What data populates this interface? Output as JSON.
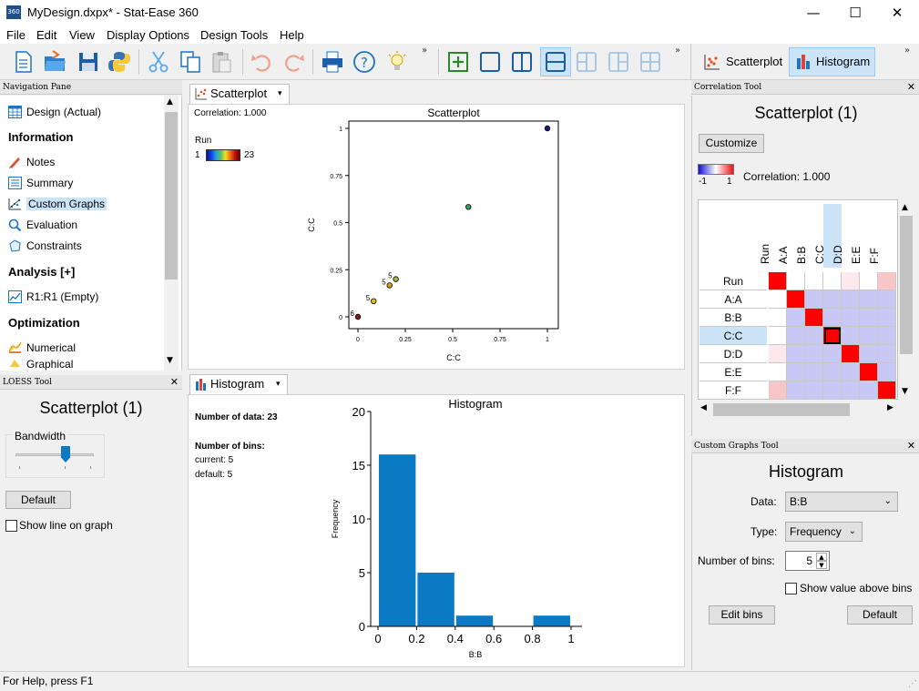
{
  "window": {
    "title": "MyDesign.dxpx* - Stat-Ease 360",
    "app_icon_text": "360",
    "minimize": "—",
    "maximize": "☐",
    "close": "✕"
  },
  "menu": [
    "File",
    "Edit",
    "View",
    "Display Options",
    "Design Tools",
    "Help"
  ],
  "toolbar": {
    "right_toggles": [
      {
        "label": "Scatterplot",
        "active": false
      },
      {
        "label": "Histogram",
        "active": true
      }
    ]
  },
  "nav_pane": {
    "header": "Navigation Pane",
    "top_item": "Design (Actual)",
    "sections": [
      {
        "title": "Information",
        "items": [
          "Notes",
          "Summary",
          "Custom Graphs",
          "Evaluation",
          "Constraints"
        ]
      },
      {
        "title": "Analysis [+]",
        "items": [
          "R1:R1 (Empty)"
        ]
      },
      {
        "title": "Optimization",
        "items": [
          "Numerical",
          "Graphical"
        ]
      }
    ],
    "selected": "Custom Graphs"
  },
  "loess_tool": {
    "header": "LOESS Tool",
    "title": "Scatterplot (1)",
    "bandwidth_label": "Bandwidth",
    "default_button": "Default",
    "show_line_label": "Show line on graph",
    "show_line_checked": false
  },
  "scatter_window": {
    "tab_label": "Scatterplot",
    "correlation_text": "Correlation: 1.000",
    "legend_title": "Run",
    "legend_min": "1",
    "legend_max": "23",
    "chart_title": "Scatterplot",
    "xlabel": "C:C",
    "ylabel": "C:C"
  },
  "histogram_window": {
    "tab_label": "Histogram",
    "number_of_data": "Number of data: 23",
    "number_of_bins": "Number of bins:",
    "current": "current: 5",
    "default": "default: 5",
    "chart_title": "Histogram",
    "xlabel": "B:B",
    "ylabel": "Frequency"
  },
  "correlation_tool": {
    "header": "Correlation Tool",
    "title": "Scatterplot (1)",
    "customize_button": "Customize",
    "scale_min": "-1",
    "scale_max": "1",
    "correlation_text": "Correlation: 1.000",
    "factors": [
      "Run",
      "A:A",
      "B:B",
      "C:C",
      "D:D",
      "E:E",
      "F:F"
    ],
    "selected_factor": "C:C"
  },
  "custom_graphs_tool": {
    "header": "Custom Graphs Tool",
    "title": "Histogram",
    "data_label": "Data:",
    "data_value": "B:B",
    "type_label": "Type:",
    "type_value": "Frequency",
    "bins_label": "Number of bins:",
    "bins_value": "5",
    "show_value_label": "Show value above bins",
    "show_value_checked": false,
    "edit_bins_button": "Edit bins",
    "default_button": "Default"
  },
  "status": "For Help, press F1",
  "chart_data": [
    {
      "type": "scatter",
      "title": "Scatterplot",
      "xlabel": "C:C",
      "ylabel": "C:C",
      "xlim": [
        0,
        1
      ],
      "ylim": [
        0,
        1
      ],
      "xticks": [
        "0",
        "0.25",
        "0.5",
        "0.75",
        "1"
      ],
      "yticks": [
        "0",
        "0.25",
        "0.5",
        "0.75",
        "1"
      ],
      "points": [
        {
          "x": 0,
          "y": 0,
          "label": "6",
          "color": "#8b1a1a"
        },
        {
          "x": 0.083,
          "y": 0.083,
          "label": "5",
          "color": "#e0c020"
        },
        {
          "x": 0.167,
          "y": 0.167,
          "label": "5",
          "color": "#d0a020"
        },
        {
          "x": 0.2,
          "y": 0.2,
          "label": "5",
          "color": "#a0c030"
        },
        {
          "x": 0.583,
          "y": 0.583,
          "label": "",
          "color": "#30a060"
        },
        {
          "x": 1,
          "y": 1,
          "label": "",
          "color": "#1a1a7a"
        }
      ]
    },
    {
      "type": "bar",
      "title": "Histogram",
      "xlabel": "B:B",
      "ylabel": "Frequency",
      "bin_edges": [
        0,
        0.2,
        0.4,
        0.6,
        0.8,
        1.0
      ],
      "values": [
        16,
        5,
        1,
        0,
        1
      ],
      "xticks": [
        "0",
        "0.2",
        "0.4",
        "0.6",
        "0.8",
        "1"
      ],
      "yticks": [
        "0",
        "5",
        "10",
        "15",
        "20"
      ],
      "ylim": [
        0,
        20
      ],
      "color": "#0a7ac4"
    }
  ],
  "colors": {
    "accent": "#0a7ac4",
    "selected_bg": "#cce4f7",
    "corr_positive": "#ff0000",
    "corr_low": "#c8c8f4"
  }
}
